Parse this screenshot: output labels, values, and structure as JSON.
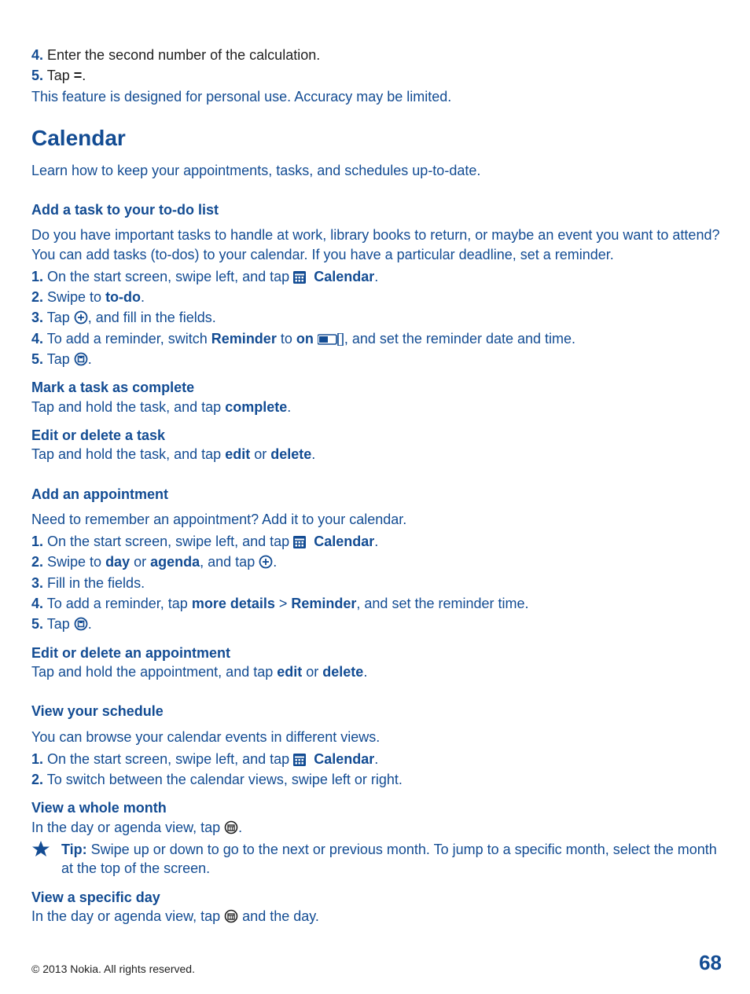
{
  "lead_steps": [
    {
      "n": "4.",
      "text": " Enter the second number of the calculation."
    },
    {
      "n": "5.",
      "pre": " Tap ",
      "bold": "=",
      "post": "."
    }
  ],
  "lead_note": "This feature is designed for personal use. Accuracy may be limited.",
  "calendar": {
    "title": "Calendar",
    "intro": "Learn how to keep your appointments, tasks, and schedules up-to-date.",
    "add_task": {
      "title": "Add a task to your to-do list",
      "intro": "Do you have important tasks to handle at work, library books to return, or maybe an event you want to attend? You can add tasks (to-dos) to your calendar. If you have a particular deadline, set a reminder.",
      "step1": {
        "n": "1.",
        "pre": " On the start screen, swipe left, and tap ",
        "bold": "Calendar",
        "post": "."
      },
      "step2": {
        "n": "2.",
        "pre": " Swipe to ",
        "bold": "to-do",
        "post": "."
      },
      "step3": {
        "n": "3.",
        "pre": " Tap ",
        "post": ", and fill in the fields."
      },
      "step4": {
        "n": "4.",
        "pre": " To add a reminder, switch ",
        "b1": "Reminder",
        "mid": " to ",
        "b2": "on",
        "post2": " ",
        "post3": ", and set the reminder date and time."
      },
      "step5": {
        "n": "5.",
        "pre": " Tap ",
        "post": "."
      },
      "mark": {
        "title": "Mark a task as complete",
        "pre": "Tap and hold the task, and tap ",
        "b": "complete",
        "post": "."
      },
      "edit": {
        "title": "Edit or delete a task",
        "pre": "Tap and hold the task, and tap ",
        "b1": "edit",
        "mid": " or ",
        "b2": "delete",
        "post": "."
      }
    },
    "add_appt": {
      "title": "Add an appointment",
      "intro": "Need to remember an appointment? Add it to your calendar.",
      "step1": {
        "n": "1.",
        "pre": " On the start screen, swipe left, and tap ",
        "bold": "Calendar",
        "post": "."
      },
      "step2": {
        "n": "2.",
        "pre": " Swipe to ",
        "b1": "day",
        "mid": " or ",
        "b2": "agenda",
        "post": ", and tap ",
        "post2": "."
      },
      "step3": {
        "n": "3.",
        "text": " Fill in the fields."
      },
      "step4": {
        "n": "4.",
        "pre": " To add a reminder, tap ",
        "b1": "more details",
        "gt": " > ",
        "b2": "Reminder",
        "post": ", and set the reminder time."
      },
      "step5": {
        "n": "5.",
        "pre": " Tap ",
        "post": "."
      },
      "edit": {
        "title": "Edit or delete an appointment",
        "pre": "Tap and hold the appointment, and tap ",
        "b1": "edit",
        "mid": " or ",
        "b2": "delete",
        "post": "."
      }
    },
    "view": {
      "title": "View your schedule",
      "intro": "You can browse your calendar events in different views.",
      "step1": {
        "n": "1.",
        "pre": " On the start screen, swipe left, and tap ",
        "bold": "Calendar",
        "post": "."
      },
      "step2": {
        "n": "2.",
        "text": " To switch between the calendar views, swipe left or right."
      },
      "month": {
        "title": "View a whole month",
        "pre": "In the day or agenda view, tap ",
        "post": "."
      },
      "tip": {
        "label": "Tip: ",
        "text": "Swipe up or down to go to the next or previous month. To jump to a specific month, select the month at the top of the screen."
      },
      "day": {
        "title": "View a specific day",
        "pre": "In the day or agenda view, tap ",
        "post": " and the day."
      }
    }
  },
  "footer": {
    "copyright": "© 2013 Nokia. All rights reserved.",
    "page": "68"
  }
}
